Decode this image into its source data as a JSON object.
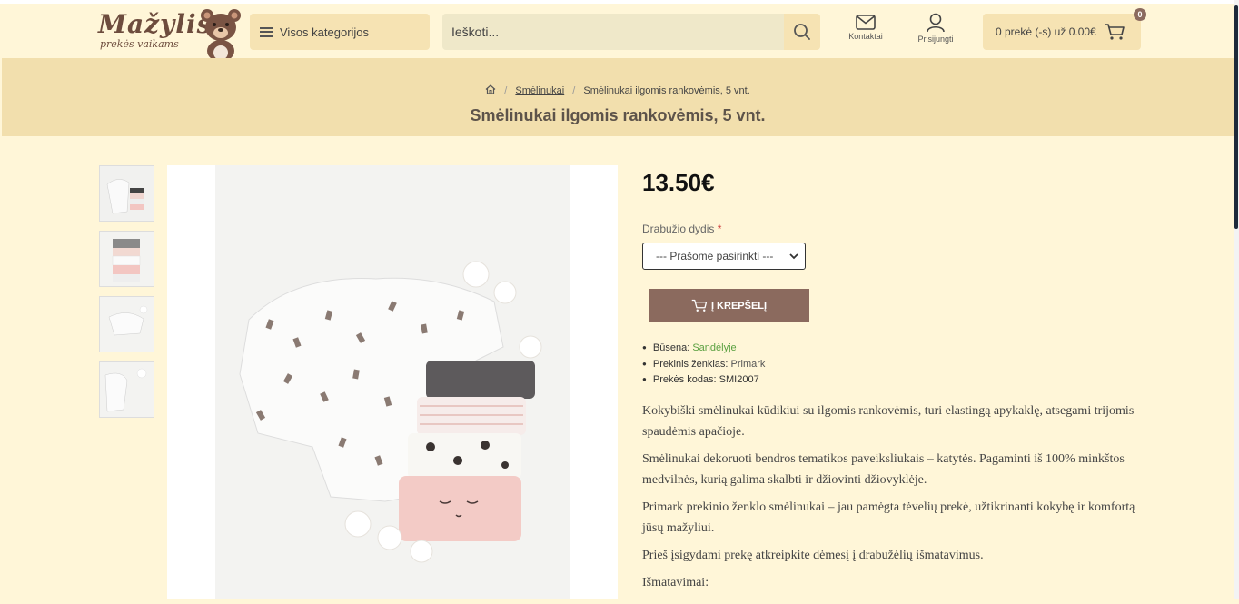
{
  "header": {
    "logo_title": "Mažylis",
    "logo_subtitle": "prekės vaikams",
    "categories_label": "Visos kategorijos",
    "search_placeholder": "Ieškoti...",
    "contacts_label": "Kontaktai",
    "login_label": "Prisijungti",
    "cart_label": "0 prekė (-s) už 0.00€",
    "cart_count": "0"
  },
  "breadcrumb": {
    "category": "Smėlinukai",
    "current": "Smėlinukai ilgomis rankovėmis, 5 vnt."
  },
  "page_title": "Smėlinukai ilgomis rankovėmis, 5 vnt.",
  "product": {
    "price": "13.50€",
    "size_label": "Drabužio dydis",
    "size_required": "*",
    "size_selected": "--- Prašome pasirinkti ---",
    "add_to_cart": "Į KREPŠELĮ",
    "status_label": "Būsena:",
    "status_value": "Sandėlyje",
    "brand_label": "Prekinis ženklas:",
    "brand_value": "Primark",
    "code_label": "Prekės kodas:",
    "code_value": "SMI2007",
    "description": [
      "Kokybiški smėlinukai kūdikiui su ilgomis rankovėmis, turi elastingą apykaklę, atsegami trijomis spaudėmis apačioje.",
      "Smėlinukai dekoruoti bendros tematikos paveiksliukais – katytės. Pagaminti iš 100% minkštos medvilnės, kurią galima skalbti ir džiovinti džiovyklėje.",
      "Primark prekinio ženklo smėlinukai – jau pamėgta tėvelių prekė, užtikrinanti kokybę ir komfortą jūsų mažyliui.",
      "Prieš įsigydami prekę atkreipkite dėmesį į drabužėlių išmatavimus.",
      "Išmatavimai:"
    ]
  },
  "colors": {
    "background": "#fff6d8",
    "banner": "#f2dfad",
    "button": "#8b6a5e",
    "stock": "#5aa040"
  }
}
